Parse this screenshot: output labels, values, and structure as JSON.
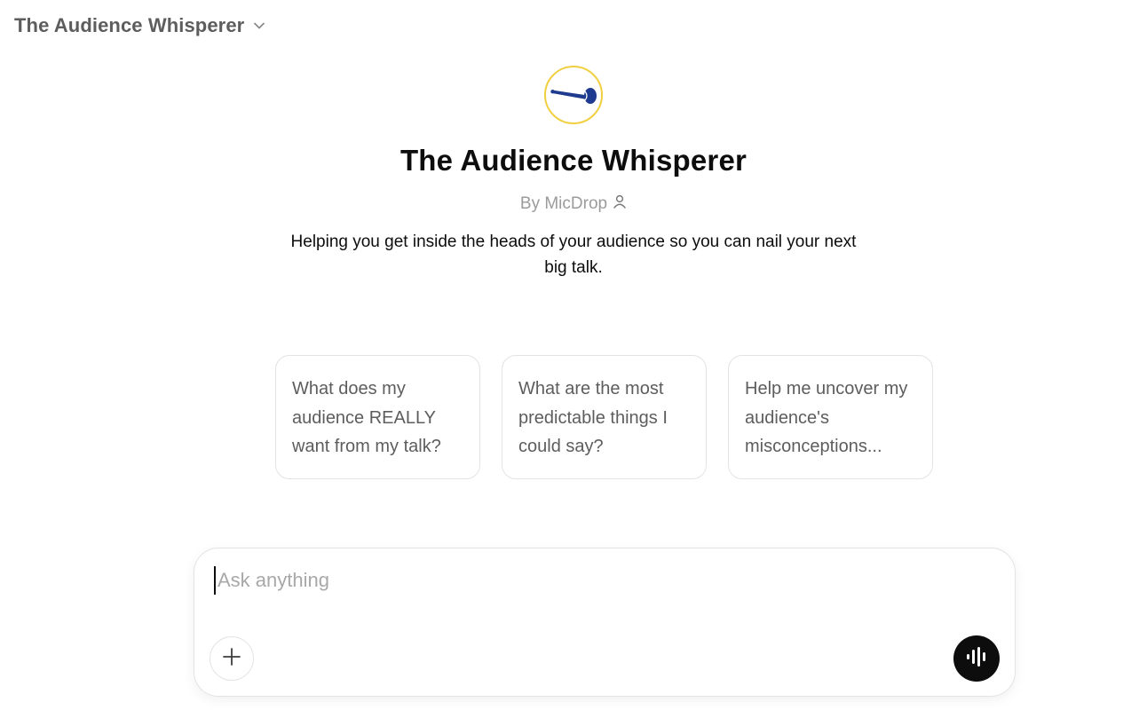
{
  "header": {
    "title": "The Audience Whisperer"
  },
  "gpt": {
    "title": "The Audience Whisperer",
    "author": "By MicDrop",
    "description": "Helping you get inside the heads of your audience so you can nail your next big talk.",
    "avatar_icon": "microphone-icon",
    "avatar_ring_color": "#f0cf40",
    "avatar_icon_color": "#1f3b8f"
  },
  "starters": [
    {
      "label": "What does my audience REALLY want from my talk?"
    },
    {
      "label": "What are the most predictable things I could say?"
    },
    {
      "label": "Help me uncover my audience's misconceptions..."
    }
  ],
  "composer": {
    "placeholder": "Ask anything",
    "value": ""
  },
  "icons": {
    "header_chevron": "chevron-down-icon",
    "author": "user-icon",
    "attach": "plus-icon",
    "voice": "voice-waveform-icon"
  }
}
